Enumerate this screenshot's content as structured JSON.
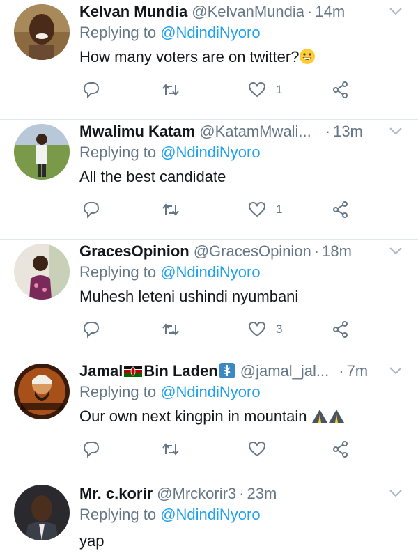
{
  "replies": [
    {
      "name": "Kelvan Mundia",
      "handle": "@KelvanMundia",
      "time": "14m",
      "replying_prefix": "Replying to",
      "replying_to": "@NdindiNyoro",
      "text": "How many voters are on twitter?",
      "text_emoji": "grinning-face",
      "like_count": "1"
    },
    {
      "name": "Mwalimu Katam",
      "handle": "@KatamMwali...",
      "time": "13m",
      "replying_prefix": "Replying to",
      "replying_to": "@NdindiNyoro",
      "text": "All the best candidate",
      "like_count": "1"
    },
    {
      "name": "GracesOpinion",
      "handle": "@GracesOpinion",
      "time": "18m",
      "replying_prefix": "Replying to",
      "replying_to": "@NdindiNyoro",
      "text": "Muhesh leteni ushindi nyumbani",
      "like_count": "3"
    },
    {
      "name_part1": "Jamal",
      "name_part2": "Bin Laden",
      "name_emojis": [
        "kenya-flag",
        "medical-symbol"
      ],
      "handle": "@jamal_jal...",
      "time": "7m",
      "replying_prefix": "Replying to",
      "replying_to": "@NdindiNyoro",
      "text": "Our own next kingpin in mountain",
      "text_emoji": "mountain-road",
      "like_count": ""
    },
    {
      "name": "Mr. c.korir",
      "handle": "@Mrckorir3",
      "time": "23m",
      "replying_prefix": "Replying to",
      "replying_to": "@NdindiNyoro",
      "text": "yap",
      "like_count": ""
    }
  ],
  "colors": {
    "link": "#1da1f2",
    "muted": "#657786",
    "text": "#14171a",
    "divider": "#e1e8ed"
  },
  "icons": [
    "reply-icon",
    "retweet-icon",
    "like-icon",
    "share-icon",
    "caret-down-icon"
  ]
}
